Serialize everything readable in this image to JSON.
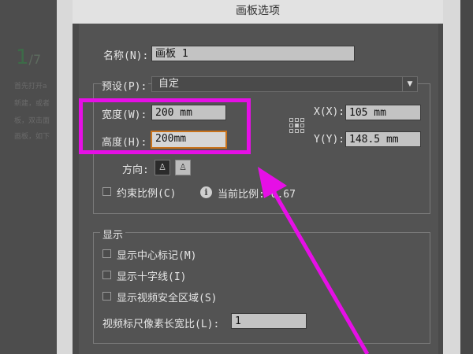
{
  "background": {
    "step_number": "1",
    "step_total": "/7",
    "text_lines": [
      "首先打开a",
      "新建，或者",
      "板，双击面",
      "画板，如下"
    ]
  },
  "dialog": {
    "title": "画板选项",
    "name_label": "名称(N):",
    "name_value": "画板 1",
    "preset_label": "预设(P):",
    "preset_value": "自定",
    "width_label": "宽度(W):",
    "width_value": "200 mm",
    "height_label": "高度(H):",
    "height_value": "200mm",
    "x_label": "X(X):",
    "x_value": "105 mm",
    "y_label": "Y(Y):",
    "y_value": "148.5 mm",
    "orientation_label": "方向:",
    "orientation_options": [
      "portrait",
      "landscape"
    ],
    "constrain_label": "约束比例(C)",
    "constrain_checked": false,
    "current_ratio_label": "当前比例: 0.67",
    "display_group_title": "显示",
    "display_options": [
      {
        "label": "显示中心标记(M)",
        "checked": false
      },
      {
        "label": "显示十字线(I)",
        "checked": false
      },
      {
        "label": "显示视频安全区域(S)",
        "checked": false
      }
    ],
    "pixel_aspect_label": "视频标尺像素长宽比(L):",
    "pixel_aspect_value": "1"
  },
  "annotation": {
    "color": "#e60fe6"
  }
}
